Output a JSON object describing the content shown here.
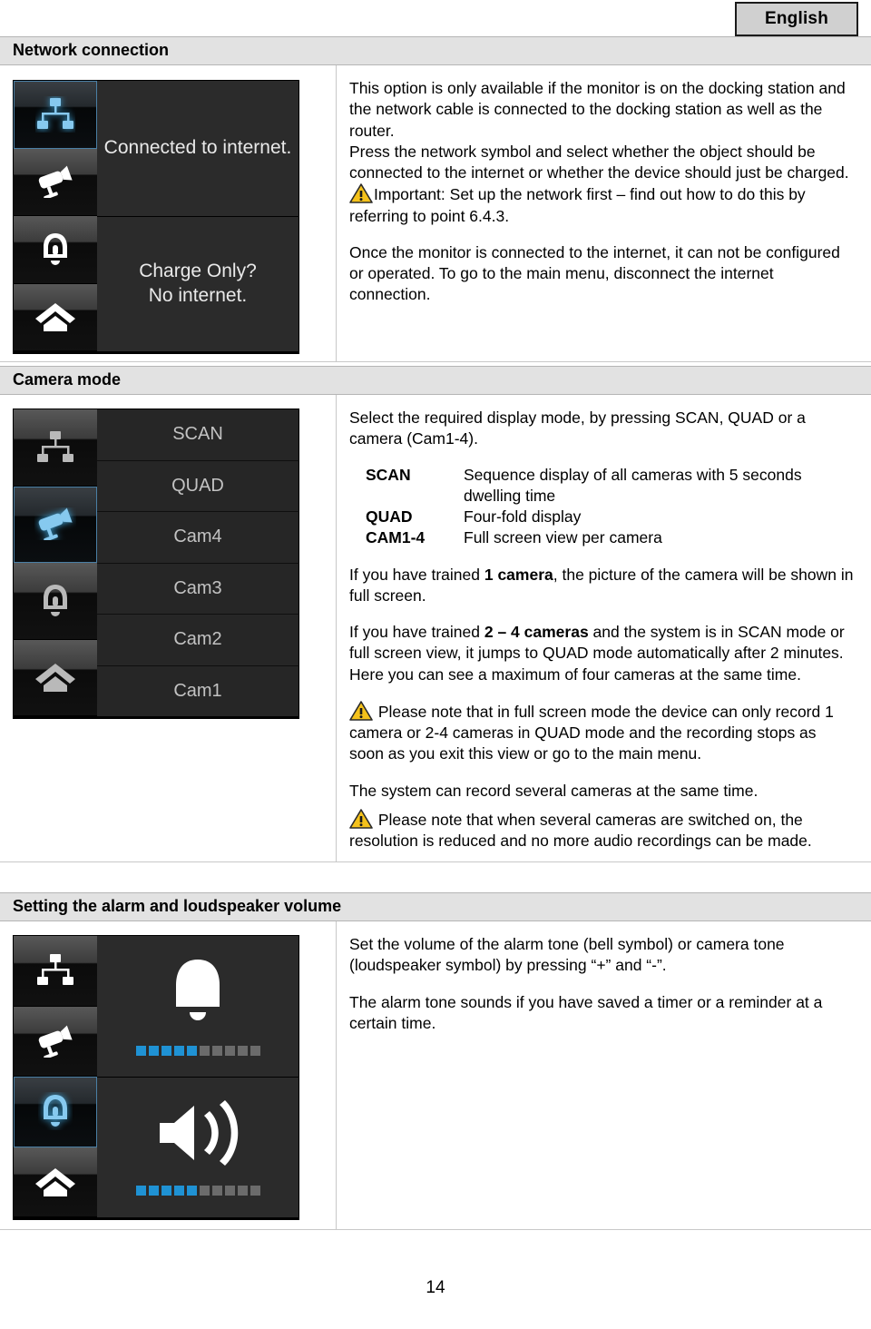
{
  "language_badge": "English",
  "page_number": "14",
  "sections": [
    {
      "id": "network",
      "title": "Network connection",
      "device": {
        "type": "network-screen",
        "sidebar_icons": [
          "network-icon",
          "camera-icon",
          "bell-icon",
          "home-icon"
        ],
        "active_icon_index": 0,
        "panes": [
          {
            "lines": [
              "Connected to internet."
            ]
          },
          {
            "lines": [
              "Charge Only?",
              "No internet."
            ]
          }
        ]
      },
      "paragraphs": [
        "This option is only available if the monitor is on the docking station and the network cable is connected to the docking station as well as the router.",
        "Press the network symbol and select whether the object should be connected to the internet or whether the device should just be charged."
      ],
      "warning": "Important: Set up the network first – find out how to do this by referring to point 6.4.3.",
      "after_warning": "Once the monitor is connected to the internet, it can not be configured or operated. To go to the main menu, disconnect the internet connection."
    },
    {
      "id": "camera-mode",
      "title": "Camera mode",
      "device": {
        "type": "camera-list-screen",
        "sidebar_icons": [
          "network-icon",
          "camera-icon",
          "bell-icon",
          "home-icon"
        ],
        "active_icon_index": 1,
        "items": [
          "SCAN",
          "QUAD",
          "Cam4",
          "Cam3",
          "Cam2",
          "Cam1"
        ]
      },
      "intro": "Select the required display mode, by pressing SCAN, QUAD or a camera (Cam1-4).",
      "definitions": [
        {
          "term": "SCAN",
          "desc": "Sequence display of all cameras with 5 seconds dwelling time"
        },
        {
          "term": "QUAD",
          "desc": "Four-fold display"
        },
        {
          "term": "CAM1-4",
          "desc": "Full screen view per camera"
        }
      ],
      "trained_one": {
        "pre": "If you have trained ",
        "bold": "1 camera",
        "post": ", the picture of the camera will be shown in full screen."
      },
      "trained_many": {
        "pre": "If you have trained ",
        "bold": "2 – 4 cameras",
        "post": " and the system is in SCAN mode or full screen view, it jumps to QUAD mode automatically after 2 minutes. Here you can see a maximum of four cameras at the same time."
      },
      "warning_1": "Please note that in full screen mode the device can only record 1 camera or 2-4 cameras in QUAD mode and the recording stops as soon as you exit this view or go to the main menu.",
      "middle_note": "The system can record several cameras at the same time.",
      "warning_2": "Please note that when several cameras are switched on, the resolution is reduced and no more audio recordings can be made."
    },
    {
      "id": "volume",
      "title": "Setting the alarm and loudspeaker volume",
      "device": {
        "type": "volume-screen",
        "sidebar_icons": [
          "network-icon",
          "camera-icon",
          "bell-icon",
          "home-icon"
        ],
        "active_icon_index": 2,
        "panes": [
          {
            "icon": "bell-icon",
            "level": 5,
            "total": 10
          },
          {
            "icon": "speaker-icon",
            "level": 5,
            "total": 10
          }
        ]
      },
      "paragraphs": [
        "Set the volume of the alarm tone (bell symbol) or camera tone (loudspeaker symbol) by pressing “+” and “-”.",
        "The alarm tone sounds if you have saved a timer or a reminder at a certain time."
      ]
    }
  ],
  "colors": {
    "accent_blue": "#1f92d4",
    "warning_yellow": "#f5c21b",
    "header_bar": "#e2e2e2",
    "device_bg": "#2b2b2b"
  }
}
